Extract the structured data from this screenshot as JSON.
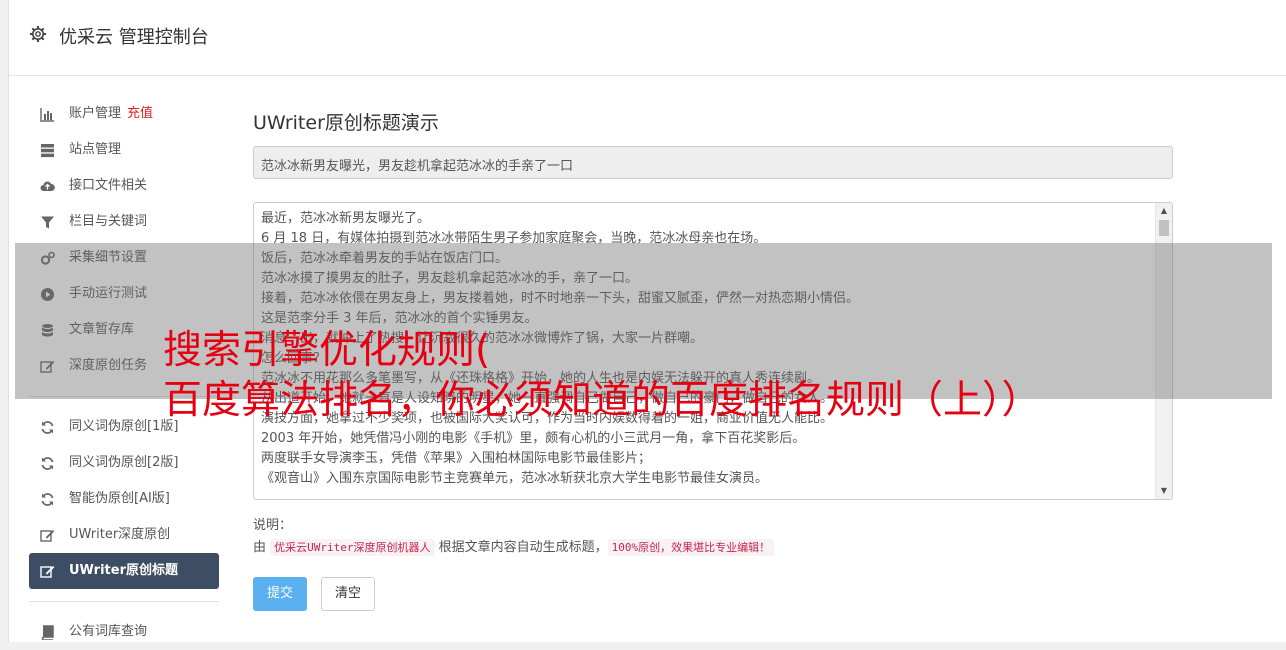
{
  "header": {
    "title": "优采云 管理控制台",
    "icon": "gear-icon"
  },
  "sidebar": {
    "items": [
      {
        "label": "账户管理",
        "badge": "充值",
        "icon": "bar-chart-icon"
      },
      {
        "label": "站点管理",
        "icon": "server-icon"
      },
      {
        "label": "接口文件相关",
        "icon": "cloud-upload-icon"
      },
      {
        "label": "栏目与关键词",
        "icon": "filter-icon"
      },
      {
        "label": "采集细节设置",
        "icon": "cogs-icon"
      },
      {
        "label": "手动运行测试",
        "icon": "play-circle-icon"
      },
      {
        "label": "文章暂存库",
        "icon": "database-icon"
      },
      {
        "label": "深度原创任务",
        "icon": "edit-icon"
      }
    ],
    "items2": [
      {
        "label": "同义词伪原创[1版]",
        "icon": "refresh-icon"
      },
      {
        "label": "同义词伪原创[2版]",
        "icon": "refresh-icon"
      },
      {
        "label": "智能伪原创[AI版]",
        "icon": "refresh-icon"
      },
      {
        "label": "UWriter深度原创",
        "icon": "edit-icon"
      },
      {
        "label": "UWriter原创标题",
        "icon": "edit-icon",
        "active": true
      }
    ],
    "items3": [
      {
        "label": "公有词库查询",
        "icon": "book-icon"
      }
    ]
  },
  "main": {
    "heading": "UWriter原创标题演示",
    "title_value": "范冰冰新男友曝光，男友趁机拿起范冰冰的手亲了一口",
    "content_lines": [
      "最近，范冰冰新男友曝光了。",
      "6 月 18 日，有媒体拍摄到范冰冰带陌生男子参加家庭聚会，当晚，范冰冰母亲也在场。",
      "饭后，范冰冰牵着男友的手站在饭店门口。",
      "范冰冰摸了摸男友的肚子，男友趁机拿起范冰冰的手，亲了一口。",
      "接着，范冰冰依偎在男友身上，男友搂着她，时不时地亲一下头，甜蜜又腻歪，俨然一对热恋期小情侣。",
      "这是范李分手 3 年后，范冰冰的首个实锤男友。",
      "消息一出，就冲上了热搜，让沉寂很久的范冰冰微博炸了锅，大家一片群嘲。",
      "怎么回事？",
      "范冰冰不用花那么多笔墨写，从《还珠格格》开始，她的人生也是内娱无法躲开的真人秀连续剧。",
      "从出道开始，她就一直是人设知晓的明星，她一直强调自己做自己，做自己的豪门，做自己的女人。",
      "演技方面，她拿过不少奖项，也被国际大奖认可，作为当时内娱数得着的一姐，商业价值无人能比。",
      "2003 年开始，她凭借冯小刚的电影《手机》里，颇有心机的小三武月一角，拿下百花奖影后。",
      "两度联手女导演李玉，凭借《苹果》入围柏林国际电影节最佳影片；",
      "《观音山》入围东京国际电影节主竞赛单元，范冰冰斩获北京大学生电影节最佳女演员。"
    ],
    "note_label": "说明：",
    "note_prefix": "由 ",
    "note_code1": "优采云UWriter深度原创机器人",
    "note_middle": " 根据文章内容自动生成标题，",
    "note_code2": "100%原创，效果堪比专业编辑！",
    "submit_label": "提交",
    "clear_label": "清空"
  },
  "overlay": {
    "line1": "搜索引擎优化规则(",
    "line2": "百度算法排名，你必须知道的百度排名规则（上））"
  },
  "colors": {
    "active_nav_bg": "#3d4d63",
    "submit_bg": "#5bb0f0",
    "badge": "#e02020",
    "overlay_text": "#e60012",
    "code_text": "#c7254e"
  }
}
